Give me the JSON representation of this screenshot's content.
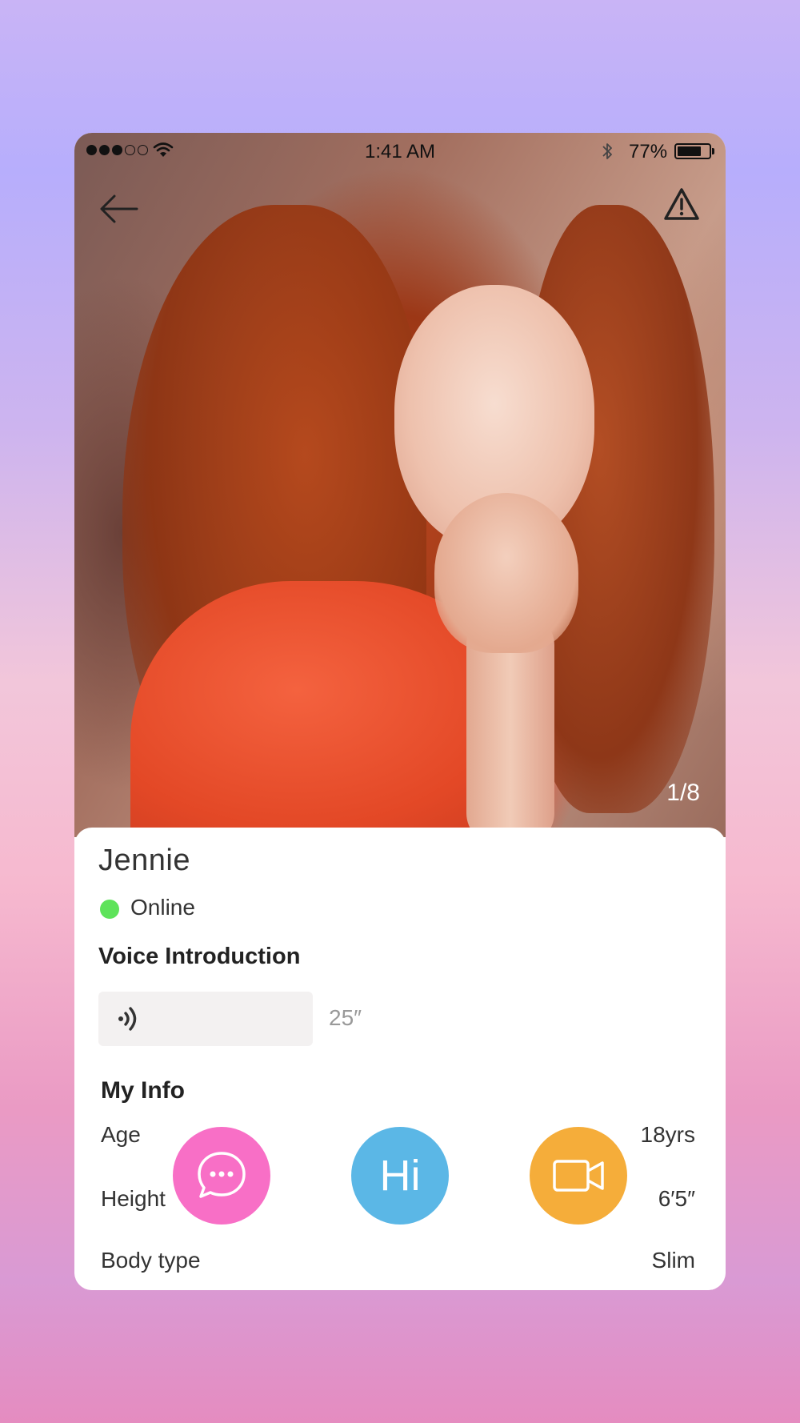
{
  "status_bar": {
    "time": "1:41 AM",
    "battery": "77%",
    "battery_level": 0.77,
    "signal_bars_filled": 3,
    "signal_bars_total": 5
  },
  "photo": {
    "counter": "1/8",
    "description_icon_left": "back-arrow-icon",
    "description_icon_right": "warning-icon"
  },
  "profile": {
    "name": "Jennie",
    "status": "Online",
    "status_color": "#5ee35a"
  },
  "voice": {
    "title": "Voice Introduction",
    "duration": "25″"
  },
  "info": {
    "title": "My Info",
    "rows": [
      {
        "label": "Age",
        "value": "18yrs"
      },
      {
        "label": "Height",
        "value": "6′5″"
      },
      {
        "label": "Body type",
        "value": "Slim"
      }
    ]
  },
  "actions": {
    "chat_icon": "chat-bubble-icon",
    "hi_label": "Hi",
    "video_icon": "video-camera-icon",
    "chat_color": "#f86fc6",
    "hi_color": "#5bb7e6",
    "video_color": "#f5ad3a"
  }
}
